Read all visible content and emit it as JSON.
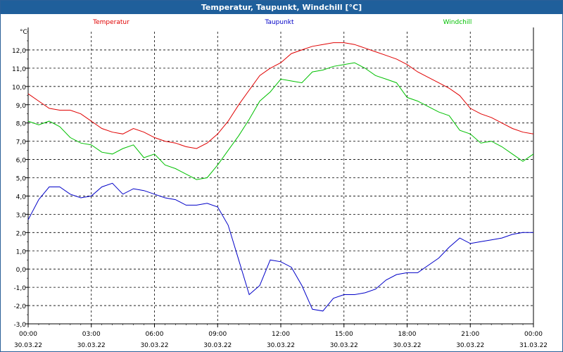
{
  "window": {
    "title": "Temperatur, Taupunkt, Windchill [°C]"
  },
  "chart_data": {
    "type": "line",
    "title": "Temperatur, Taupunkt, Windchill [°C]",
    "ylabel": "°C",
    "ylim": [
      -3.0,
      13.0
    ],
    "xlim": [
      0,
      24
    ],
    "grid": true,
    "legend_position": "top",
    "y_ticks": [
      "12,0",
      "11,0",
      "10,0",
      "9,0",
      "8,0",
      "7,0",
      "6,0",
      "5,0",
      "4,0",
      "3,0",
      "2,0",
      "1,0",
      "0,0",
      "-1,0",
      "-2,0",
      "-3,0"
    ],
    "x_ticks": [
      {
        "time": "00:00",
        "date": "30.03.22"
      },
      {
        "time": "03:00",
        "date": "30.03.22"
      },
      {
        "time": "06:00",
        "date": "30.03.22"
      },
      {
        "time": "09:00",
        "date": "30.03.22"
      },
      {
        "time": "12:00",
        "date": "30.03.22"
      },
      {
        "time": "15:00",
        "date": "30.03.22"
      },
      {
        "time": "18:00",
        "date": "30.03.22"
      },
      {
        "time": "21:00",
        "date": "30.03.22"
      },
      {
        "time": "00:00",
        "date": "31.03.22"
      }
    ],
    "series": [
      {
        "name": "Temperatur",
        "color": "#e00000",
        "x": [
          0,
          0.5,
          1,
          1.5,
          2,
          2.5,
          3,
          3.5,
          4,
          4.5,
          5,
          5.5,
          6,
          6.5,
          7,
          7.5,
          8,
          8.5,
          9,
          9.5,
          10,
          10.5,
          11,
          11.5,
          12,
          12.5,
          13,
          13.5,
          14,
          14.5,
          15,
          15.5,
          16,
          16.5,
          17,
          17.5,
          18,
          18.5,
          19,
          19.5,
          20,
          20.5,
          21,
          21.5,
          22,
          22.5,
          23,
          23.5,
          24
        ],
        "values": [
          9.6,
          9.2,
          8.8,
          8.7,
          8.7,
          8.5,
          8.1,
          7.7,
          7.5,
          7.4,
          7.7,
          7.5,
          7.2,
          7.0,
          6.9,
          6.7,
          6.6,
          6.9,
          7.4,
          8.1,
          9.0,
          9.8,
          10.6,
          11.0,
          11.3,
          11.8,
          12.0,
          12.2,
          12.3,
          12.4,
          12.4,
          12.3,
          12.1,
          11.9,
          11.7,
          11.5,
          11.2,
          10.8,
          10.5,
          10.2,
          9.9,
          9.5,
          8.8,
          8.5,
          8.3,
          8.0,
          7.7,
          7.5,
          7.4
        ]
      },
      {
        "name": "Taupunkt",
        "color": "#0000c8",
        "x": [
          0,
          0.5,
          1,
          1.5,
          2,
          2.5,
          3,
          3.5,
          4,
          4.5,
          5,
          5.5,
          6,
          6.5,
          7,
          7.5,
          8,
          8.5,
          9,
          9.5,
          10,
          10.5,
          11,
          11.5,
          12,
          12.5,
          13,
          13.5,
          14,
          14.5,
          15,
          15.5,
          16,
          16.5,
          17,
          17.5,
          18,
          18.5,
          19,
          19.5,
          20,
          20.5,
          21,
          21.5,
          22,
          22.5,
          23,
          23.5,
          24
        ],
        "values": [
          2.7,
          3.8,
          4.5,
          4.5,
          4.1,
          3.9,
          4.0,
          4.5,
          4.7,
          4.1,
          4.4,
          4.3,
          4.1,
          3.9,
          3.8,
          3.5,
          3.5,
          3.6,
          3.4,
          2.4,
          0.5,
          -1.4,
          -0.9,
          0.5,
          0.4,
          0.1,
          -0.9,
          -2.2,
          -2.3,
          -1.6,
          -1.4,
          -1.4,
          -1.3,
          -1.1,
          -0.6,
          -0.3,
          -0.2,
          -0.2,
          0.2,
          0.6,
          1.2,
          1.7,
          1.4,
          1.5,
          1.6,
          1.7,
          1.9,
          2.0,
          2.0
        ]
      },
      {
        "name": "Windchill",
        "color": "#00c000",
        "x": [
          0,
          0.5,
          1,
          1.5,
          2,
          2.5,
          3,
          3.5,
          4,
          4.5,
          5,
          5.5,
          6,
          6.5,
          7,
          7.5,
          8,
          8.5,
          9,
          9.5,
          10,
          10.5,
          11,
          11.5,
          12,
          12.5,
          13,
          13.5,
          14,
          14.5,
          15,
          15.5,
          16,
          16.5,
          17,
          17.5,
          18,
          18.5,
          19,
          19.5,
          20,
          20.5,
          21,
          21.5,
          22,
          22.5,
          23,
          23.5,
          24
        ],
        "values": [
          8.1,
          7.9,
          8.1,
          7.8,
          7.2,
          6.9,
          6.8,
          6.4,
          6.3,
          6.6,
          6.8,
          6.1,
          6.3,
          5.7,
          5.5,
          5.2,
          4.9,
          5.0,
          5.7,
          6.5,
          7.3,
          8.2,
          9.2,
          9.7,
          10.4,
          10.3,
          10.2,
          10.8,
          10.9,
          11.1,
          11.2,
          11.3,
          11.0,
          10.6,
          10.4,
          10.2,
          9.4,
          9.2,
          8.9,
          8.6,
          8.4,
          7.6,
          7.4,
          6.9,
          7.0,
          6.7,
          6.3,
          5.9,
          6.3
        ]
      }
    ]
  }
}
